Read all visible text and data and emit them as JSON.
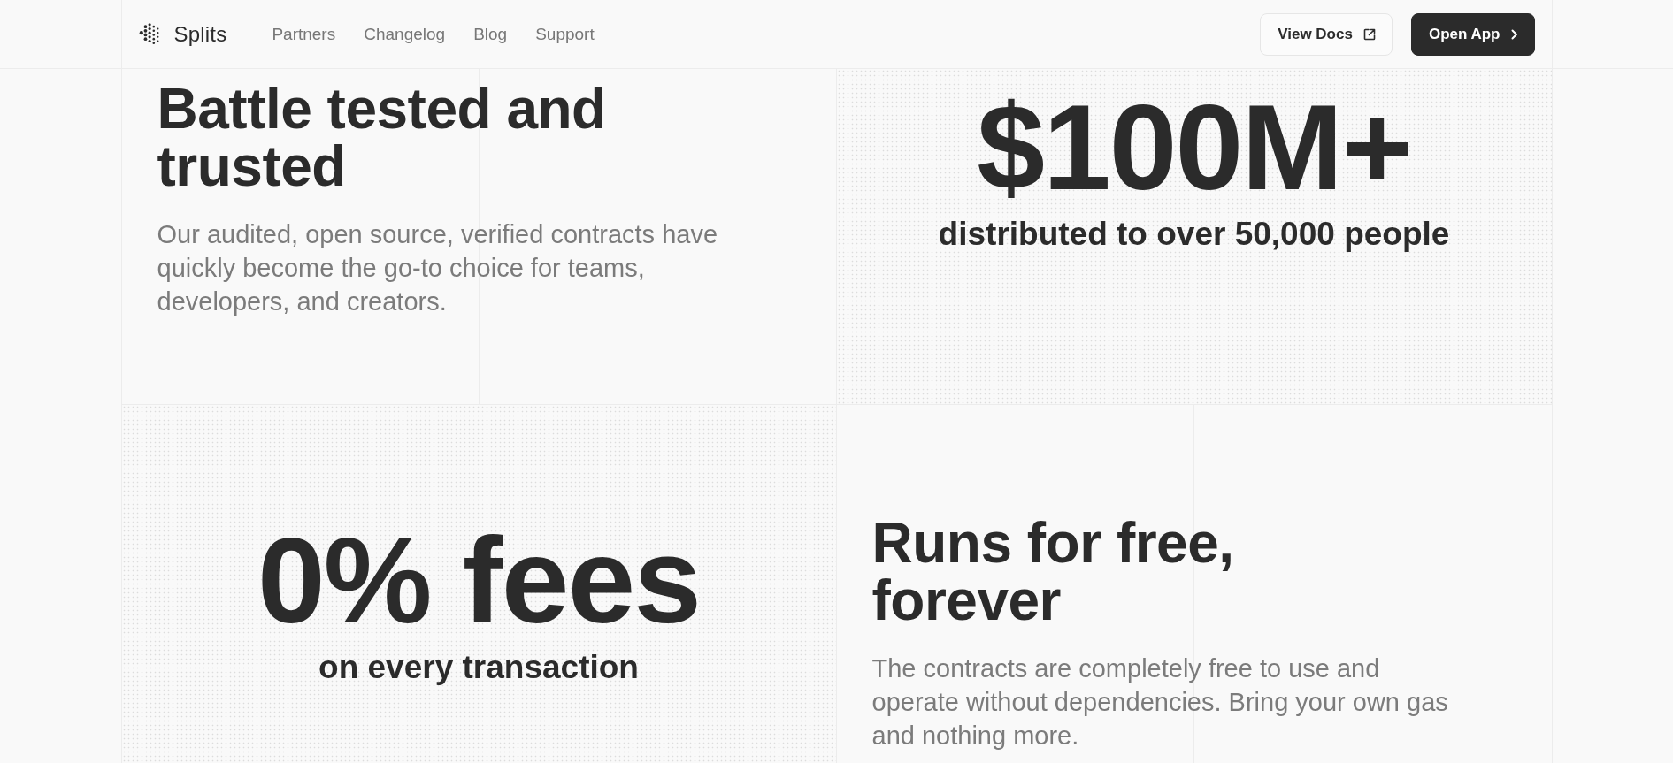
{
  "header": {
    "brand": "Splits",
    "links": [
      {
        "label": "Partners"
      },
      {
        "label": "Changelog"
      },
      {
        "label": "Blog"
      },
      {
        "label": "Support"
      }
    ],
    "buttons": [
      {
        "label": "View Docs",
        "kind": "secondary"
      },
      {
        "label": "Open App",
        "kind": "primary"
      }
    ]
  },
  "features": [
    {
      "kind": "text",
      "title": "Battle tested and trusted",
      "body": "Our audited, open source, verified contracts have quickly become the go-to choice for teams, developers, and creators."
    },
    {
      "kind": "stat",
      "value": "$100M+",
      "caption": "distributed to over 50,000 people"
    },
    {
      "kind": "stat",
      "value": "0% fees",
      "caption": "on every transaction"
    },
    {
      "kind": "text",
      "title": "Runs for free, forever",
      "body": "The contracts are completely free to use and operate without dependencies. Bring your own gas and nothing more."
    }
  ]
}
